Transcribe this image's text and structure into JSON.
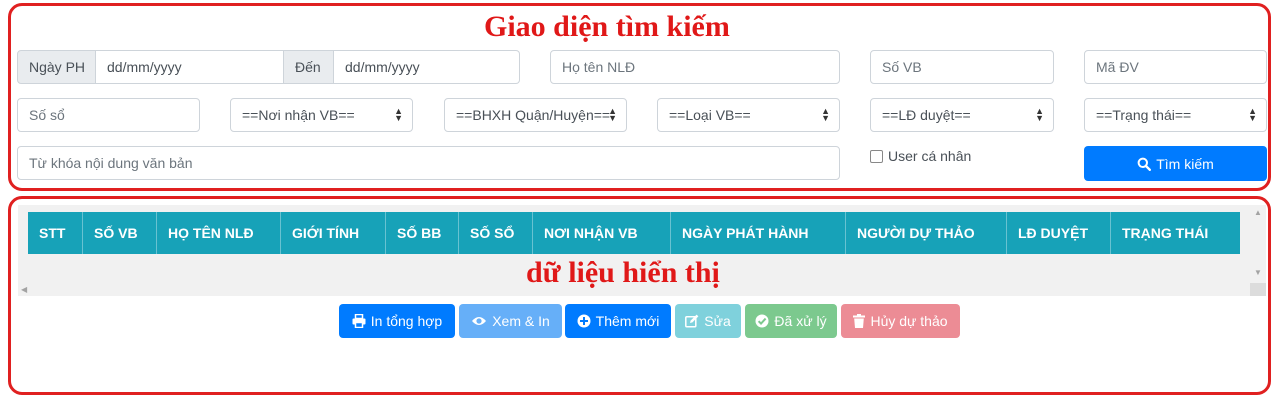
{
  "annotations": {
    "search_area": "Giao diện tìm kiếm",
    "data_area": "dữ liệu hiển thị"
  },
  "search": {
    "date_from_label": "Ngày PH",
    "date_from_placeholder": "dd/mm/yyyy",
    "date_to_label": "Đến",
    "date_to_placeholder": "dd/mm/yyyy",
    "employee_name_placeholder": "Họ tên NLĐ",
    "doc_number_placeholder": "Số VB",
    "unit_code_placeholder": "Mã ĐV",
    "book_number_placeholder": "Số sổ",
    "recipient_select": "==Nơi nhận VB==",
    "district_select": "==BHXH Quận/Huyện==",
    "doc_type_select": "==Loại VB==",
    "approver_select": "==LĐ duyệt==",
    "status_select": "==Trạng thái==",
    "keyword_placeholder": "Từ khóa nội dung văn bản",
    "personal_user_label": "User cá nhân",
    "personal_user_checked": false,
    "search_button": "Tìm kiếm"
  },
  "table": {
    "columns": [
      "STT",
      "SỐ VB",
      "HỌ TÊN NLĐ",
      "GIỚI TÍNH",
      "SỐ BB",
      "SỐ SỔ",
      "NƠI NHẬN VB",
      "NGÀY PHÁT HÀNH",
      "NGƯỜI DỰ THẢO",
      "LĐ DUYỆT",
      "TRẠNG THÁI"
    ],
    "rows": []
  },
  "actions": {
    "print_summary": "In tổng hợp",
    "view_print": "Xem & In",
    "add_new": "Thêm mới",
    "edit": "Sửa",
    "processed": "Đã xử lý",
    "cancel_draft": "Hủy dự thảo"
  },
  "colors": {
    "primary": "#007bff",
    "table_header": "#17a2b8",
    "annotation": "#e01818"
  }
}
